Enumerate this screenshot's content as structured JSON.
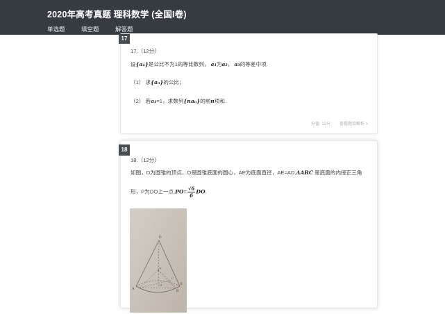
{
  "header": {
    "title": "2020年高考真题 理科数学 (全国I卷)",
    "tabs": [
      "单选题",
      "填空题",
      "解答题"
    ]
  },
  "q17": {
    "number": "17",
    "head": "17.（12分）",
    "l1_a": "设",
    "l1_an": "{aₙ}",
    "l1_b": "是公比不为1的等比数列，",
    "l1_a1": "a₁",
    "l1_c": "为",
    "l1_a2": "a₂",
    "l1_d": "，",
    "l1_a3": "a₃",
    "l1_e": "的等差中项.",
    "p1_a": "（1）  求",
    "p1_an": "{aₙ}",
    "p1_b": "的公比；",
    "p2_a": "（2）  若",
    "p2_a1": "a₁",
    "p2_b": "=1，求数列",
    "p2_nan": "{naₙ}",
    "p2_c": "的前",
    "p2_n": "n",
    "p2_d": "项和.",
    "score": "分值: 12分",
    "analysis": "查看题目解析 >"
  },
  "q18": {
    "number": "18",
    "head": "18.（12分）",
    "l1_a": "如图，D为圆锥的顶点，O是圆锥底面的圆心，AE为底面直径，AE=AD,",
    "l1_tri": "ΔABC",
    "l1_b": "是底面的内接正三角",
    "l2_a": "形，P为DO上一点,",
    "l2_po": "PO",
    "l2_eq": "=",
    "l2_num": "√6",
    "l2_den": "6",
    "l2_do": "DO",
    "l2_end": "."
  },
  "figure": {
    "labels": [
      "D",
      "P",
      "O",
      "A",
      "B",
      "C",
      "E"
    ]
  }
}
